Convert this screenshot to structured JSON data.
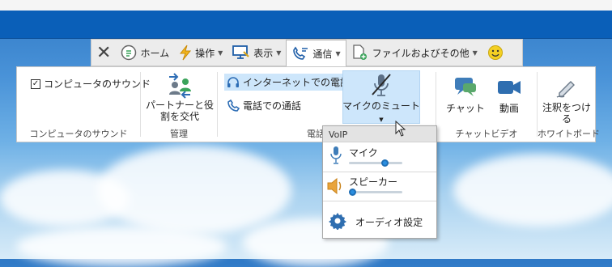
{
  "menubar": {
    "home": "ホーム",
    "operation": "操作",
    "display": "表示",
    "call": "通信",
    "files": "ファイルおよびその他"
  },
  "ribbon": {
    "computer_sound_check": "コンピュータのサウンド",
    "computer_sound_group": "コンピュータのサウンド",
    "switch_partner": "パートナーと役\n割を交代",
    "manage_group": "管理",
    "internet_call": "インターネットでの電話",
    "phone_call": "電話での通話",
    "call_group": "電話",
    "mic_mute": "マイクのミュート",
    "chat": "チャット",
    "video": "動画",
    "chat_video_group": "チャットビデオ",
    "annotate": "注釈をつけ\nる",
    "whiteboard_group": "ホワイトボード"
  },
  "dropdown": {
    "header": "VoIP",
    "mic_label": "マイク",
    "mic_level": 0.7,
    "speaker_label": "スピーカー",
    "speaker_level": 0.0,
    "audio_settings": "オーディオ設定"
  },
  "icons": {
    "close": "close-icon",
    "home": "home-icon",
    "operation": "lightning-icon",
    "display": "monitor-icon",
    "call": "phone-icon",
    "files": "file-plus-icon",
    "smiley": "smiley-icon"
  }
}
